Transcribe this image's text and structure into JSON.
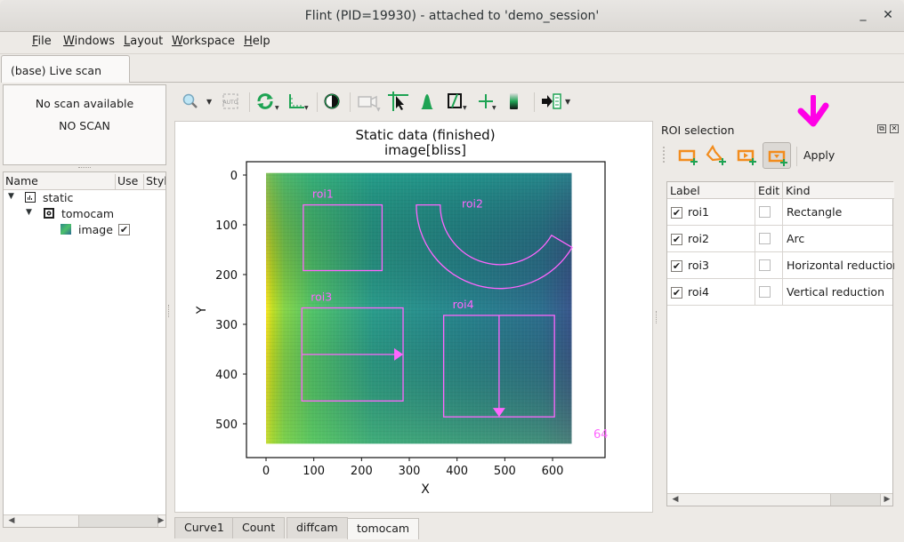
{
  "window": {
    "title": "Flint (PID=19930) - attached to 'demo_session'",
    "minimize_glyph": "_",
    "close_glyph": "✕"
  },
  "menubar": {
    "items": [
      {
        "label_u": "F",
        "label_rest": "ile"
      },
      {
        "label_u": "W",
        "label_rest": "indows"
      },
      {
        "label_u": "L",
        "label_rest": "ayout"
      },
      {
        "label_u": "W",
        "label_rest": "orkspace"
      },
      {
        "label_u": "H",
        "label_rest": "elp"
      }
    ]
  },
  "dock_tab": "(base) Live scan",
  "scan_status": {
    "line1": "No scan available",
    "line2": "NO SCAN"
  },
  "tree": {
    "columns": [
      "Name",
      "Use",
      "Style"
    ],
    "rows": [
      {
        "label": "static",
        "icon": "plot-icon",
        "expanded": true
      },
      {
        "label": "tomocam",
        "icon": "camera-device-icon",
        "expanded": true
      },
      {
        "label": "image",
        "icon": "image-icon",
        "use": "✔"
      }
    ]
  },
  "toolbar": {
    "tools": [
      "zoom-icon",
      "autoscale-icon",
      "reset-zoom-icon",
      "axis-options-icon",
      "colormap-icon",
      "camera-icon",
      "crosshair-pointer-icon",
      "profile-icon",
      "aspect-ratio-icon",
      "crosshair-icon",
      "colorbar-icon",
      "export-icon"
    ]
  },
  "plot": {
    "title_line1": "Static data (finished)",
    "title_line2": "image[bliss]",
    "xlabel": "X",
    "ylabel": "Y",
    "x_ticks": [
      "0",
      "100",
      "200",
      "300",
      "400",
      "500",
      "600"
    ],
    "y_ticks": [
      "0",
      "100",
      "200",
      "300",
      "400",
      "500"
    ],
    "overflow_label": "64",
    "roi_color": "#ff66ff",
    "rois": [
      {
        "name": "roi1",
        "kind": "rectangle",
        "x0": 78,
        "y0": 60,
        "x1": 243,
        "y1": 192
      },
      {
        "name": "roi2",
        "kind": "arc",
        "cx": 490,
        "cy": 60,
        "r_inner": 120,
        "r_outer": 168
      },
      {
        "name": "roi3",
        "kind": "horizontal-reduction",
        "x0": 75,
        "y0": 267,
        "x1": 287,
        "y1": 454
      },
      {
        "name": "roi4",
        "kind": "vertical-reduction",
        "x0": 372,
        "y0": 282,
        "x1": 604,
        "y1": 486
      }
    ]
  },
  "bottom_tabs": [
    "Curve1",
    "Count",
    "diffcam",
    "tomocam"
  ],
  "active_bottom_tab": "tomocam",
  "roi_panel": {
    "title": "ROI selection",
    "float_glyph": "⧉",
    "close_glyph": "✕",
    "apply_label": "Apply",
    "annotation_arrow_color": "#ff00e6",
    "columns": [
      "Label",
      "Edit",
      "Kind"
    ],
    "rows": [
      {
        "label": "roi1",
        "checked": "✔",
        "kind": "Rectangle"
      },
      {
        "label": "roi2",
        "checked": "✔",
        "kind": "Arc"
      },
      {
        "label": "roi3",
        "checked": "✔",
        "kind": "Horizontal reduction"
      },
      {
        "label": "roi4",
        "checked": "✔",
        "kind": "Vertical reduction"
      }
    ]
  }
}
